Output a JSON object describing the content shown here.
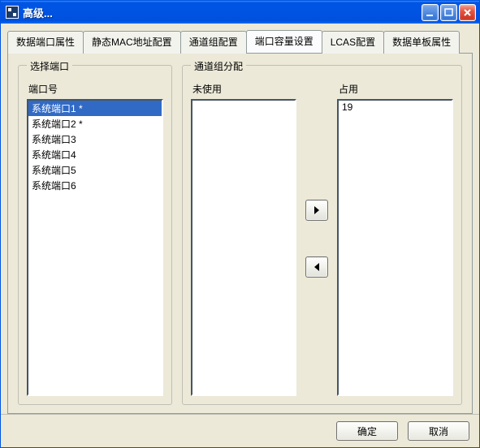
{
  "window": {
    "title": "高级..."
  },
  "tabs": [
    {
      "label": "数据端口属性"
    },
    {
      "label": "静态MAC地址配置"
    },
    {
      "label": "通道组配置"
    },
    {
      "label": "端口容量设置"
    },
    {
      "label": "LCAS配置"
    },
    {
      "label": "数据单板属性"
    }
  ],
  "active_tab_index": 3,
  "groupbox_left": {
    "legend": "选择端口",
    "col_label": "端口号",
    "items": [
      "系统端口1 *",
      "系统端口2 *",
      "系统端口3",
      "系统端口4",
      "系统端口5",
      "系统端口6"
    ],
    "selected_index": 0
  },
  "groupbox_right": {
    "legend": "通道组分配",
    "unused_label": "未使用",
    "used_label": "占用",
    "unused_items": [],
    "used_items": [
      "19"
    ]
  },
  "buttons": {
    "ok": "确定",
    "cancel": "取消"
  }
}
